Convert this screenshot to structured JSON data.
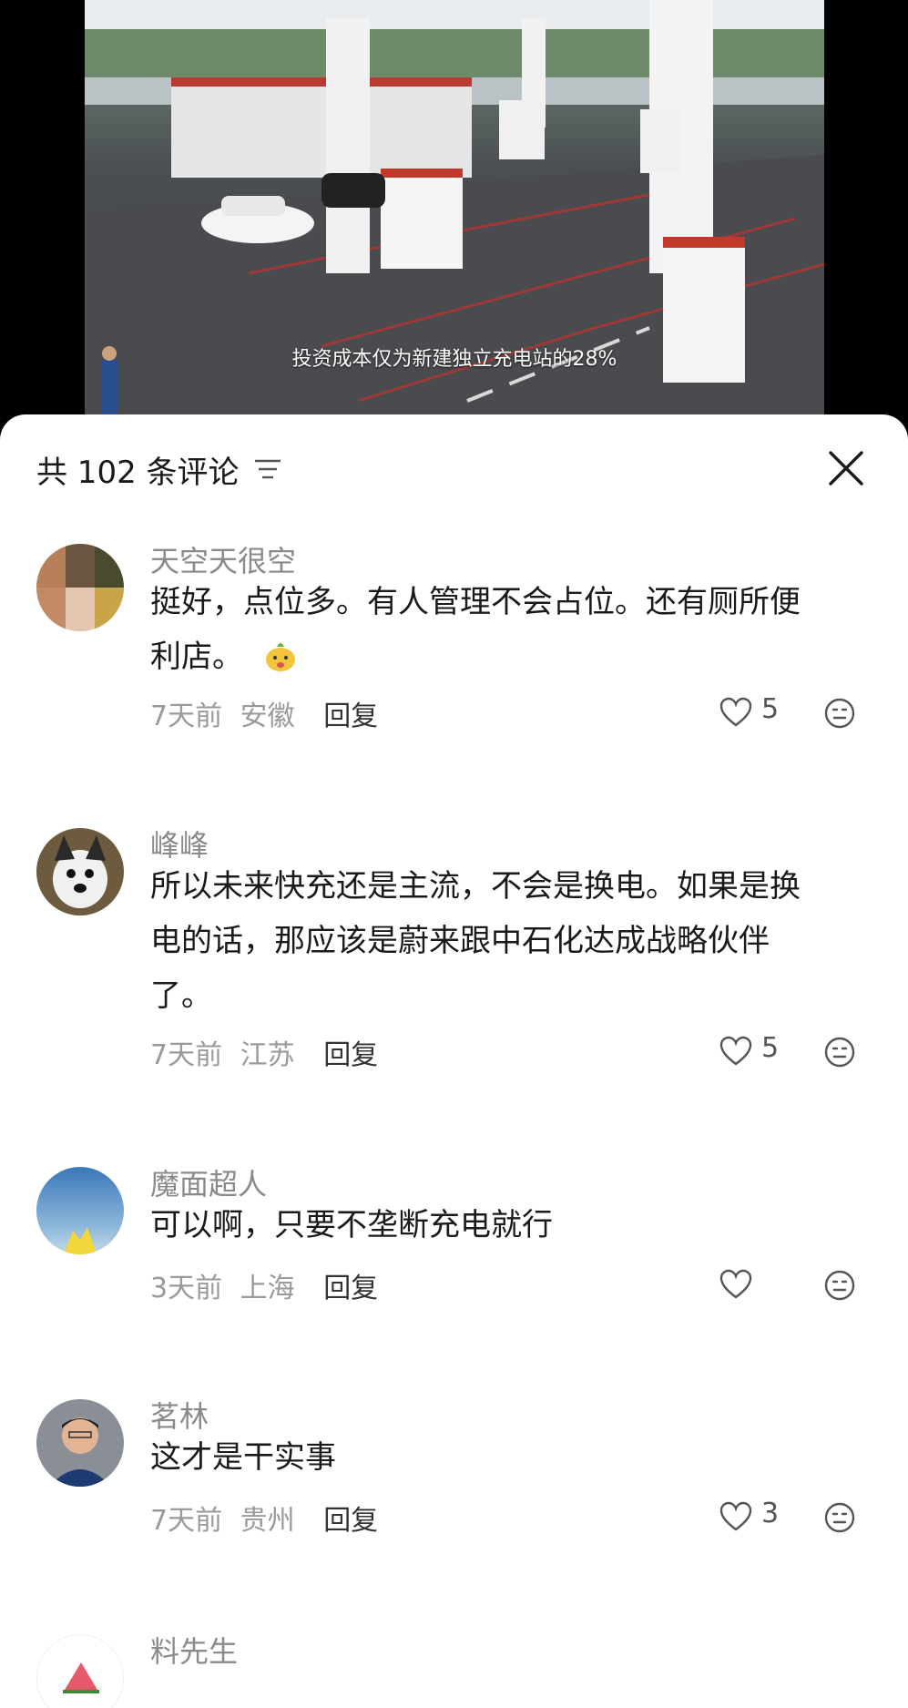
{
  "video": {
    "subtitle": "投资成本仅为新建独立充电站的28%"
  },
  "comments_sheet": {
    "title": "共 102 条评论",
    "comments": [
      {
        "username": "天空天很空",
        "text_lines": [
          "挺好，点位多。有人管理不会占位。还有厕所便",
          "利店。"
        ],
        "emoji": "sticker-emoji",
        "time": "7天前",
        "location": "安徽",
        "reply": "回复",
        "likes": "5"
      },
      {
        "username": "峰峰",
        "text_lines": [
          "所以未来快充还是主流，不会是换电。如果是换",
          "电的话，那应该是蔚来跟中石化达成战略伙伴",
          "了。"
        ],
        "time": "7天前",
        "location": "江苏",
        "reply": "回复",
        "likes": "5"
      },
      {
        "username": "魔面超人",
        "text_lines": [
          "可以啊，只要不垄断充电就行"
        ],
        "time": "3天前",
        "location": "上海",
        "reply": "回复",
        "likes": ""
      },
      {
        "username": "茗林",
        "text_lines": [
          "这才是干实事"
        ],
        "time": "7天前",
        "location": "贵州",
        "reply": "回复",
        "likes": "3"
      },
      {
        "username": "料先生"
      }
    ]
  },
  "icons": {
    "filter": "filter-icon",
    "close": "close-icon",
    "like": "heart-icon",
    "dislike": "dislike-face-icon"
  },
  "colors": {
    "sheet_bg": "#ffffff",
    "username": "#8a8a8a",
    "text": "#1a1a1a",
    "meta": "#9a9a9a"
  }
}
